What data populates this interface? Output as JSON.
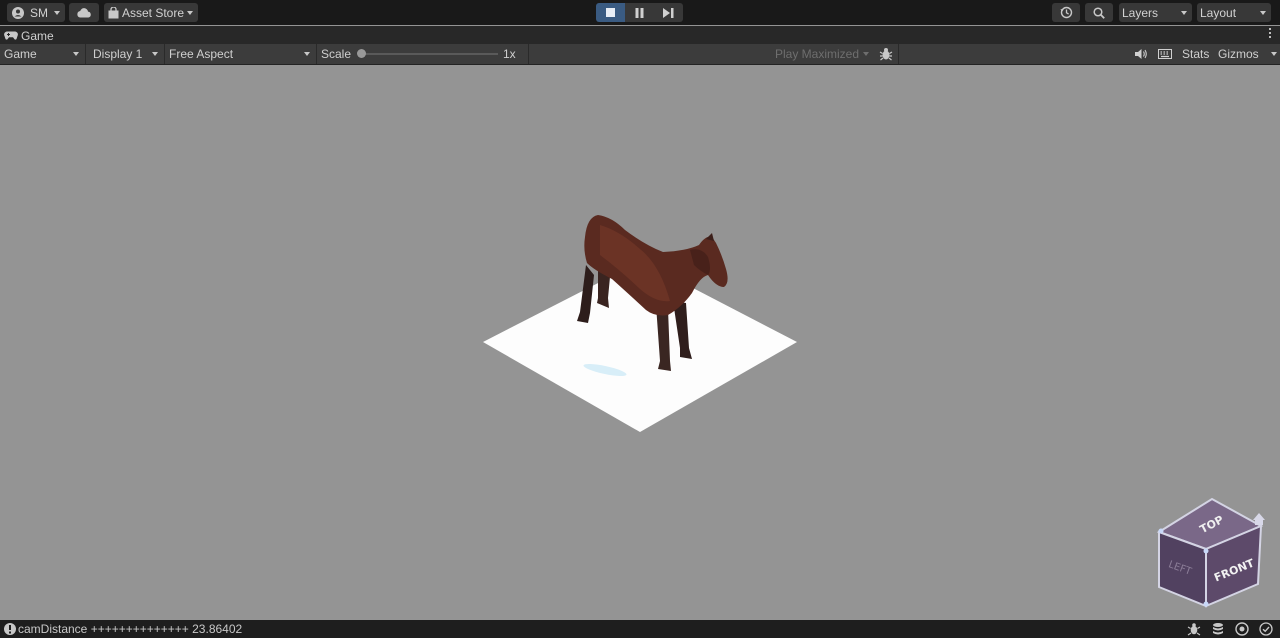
{
  "toolbar": {
    "account_label": "SM",
    "asset_store_label": "Asset Store",
    "layers_label": "Layers",
    "layout_label": "Layout"
  },
  "tab": {
    "label": "Game"
  },
  "game_toolbar": {
    "mode_label": "Game",
    "display_label": "Display 1",
    "aspect_label": "Free Aspect",
    "scale_label": "Scale",
    "scale_value": "1x",
    "scale_fraction": 0.0,
    "play_maximized_label": "Play Maximized",
    "stats_label": "Stats",
    "gizmos_label": "Gizmos"
  },
  "orientation_cube": {
    "top_label": "TOP",
    "left_label": "LEFT",
    "front_label": "FRONT"
  },
  "status": {
    "message": "camDistance ++++++++++++++ 23.86402"
  },
  "colors": {
    "play_active": "#3a5b82",
    "viewport_bg": "#949494",
    "toolbar_bg": "#191919",
    "horse": "#5a2a20",
    "cube_face": "#5d4a6a"
  }
}
